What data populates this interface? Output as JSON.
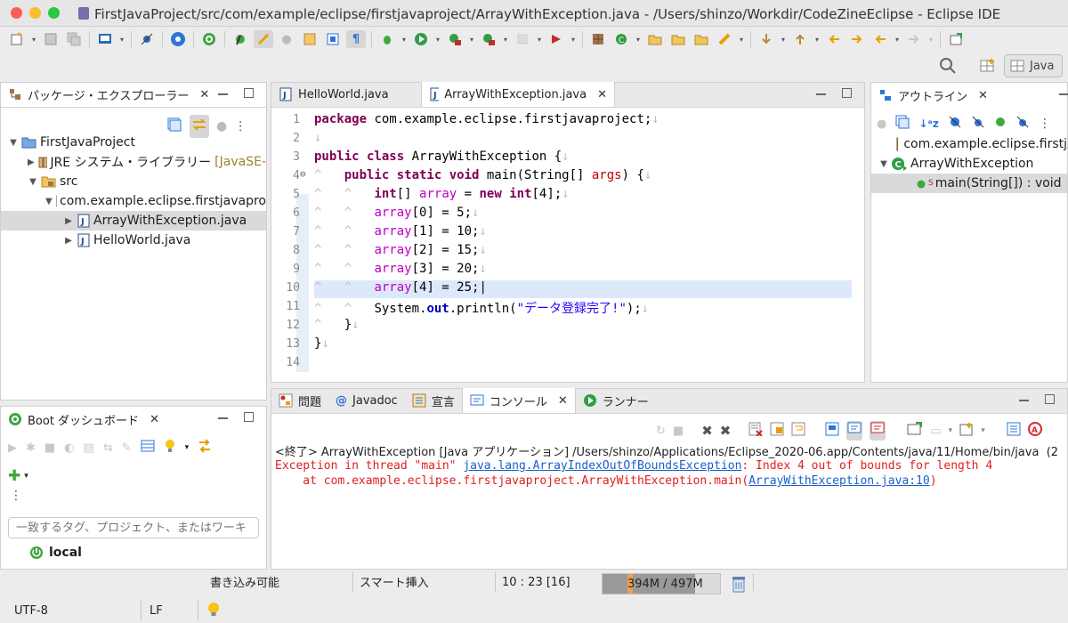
{
  "window": {
    "title": "FirstJavaProject/src/com/example/eclipse/firstjavaproject/ArrayWithException.java - /Users/shinzo/Workdir/CodeZineEclipse - Eclipse IDE",
    "perspective": "Java"
  },
  "colors": {
    "close": "#fc5f57",
    "minimize": "#fdbc2e",
    "zoom": "#28c840",
    "accent": "#2e74d8"
  },
  "explorer": {
    "tab_label": "パッケージ・エクスプローラー",
    "tree": [
      {
        "label": "FirstJavaProject",
        "icon": "project-folder-icon",
        "twisty": "▼"
      },
      {
        "label": "JRE システム・ライブラリー",
        "suffix": "[JavaSE-",
        "icon": "library-icon",
        "twisty": "▶"
      },
      {
        "label": "src",
        "icon": "source-folder-icon",
        "twisty": "▼"
      },
      {
        "label": "com.example.eclipse.firstjavapro",
        "icon": "package-icon",
        "twisty": "▼"
      },
      {
        "label": "ArrayWithException.java",
        "icon": "java-file-icon",
        "twisty": "▶"
      },
      {
        "label": "HelloWorld.java",
        "icon": "java-file-icon",
        "twisty": "▶"
      }
    ]
  },
  "boot": {
    "tab_label": "Boot ダッシュボード",
    "filter_placeholder": "一致するタグ、プロジェクト、またはワーキ",
    "local_label": "local"
  },
  "editor": {
    "tabs": [
      {
        "label": "HelloWorld.java"
      },
      {
        "label": "ArrayWithException.java",
        "active": true
      }
    ],
    "line_numbers": [
      "1",
      "2",
      "3",
      "4",
      "5",
      "6",
      "7",
      "8",
      "9",
      "10",
      "11",
      "12",
      "13",
      "14"
    ],
    "cursor_line": 10,
    "lines": [
      "<span class=\"kw\">package</span> com.example.eclipse.firstjavaproject;<span class=\"ws\">↓</span>",
      "<span class=\"ws\">↓</span>",
      "<span class=\"kw\">public class</span> ArrayWithException {<span class=\"ws\">↓</span>",
      "<span class=\"ws\">^   </span><span class=\"kw\">public static void</span> main(String[] <span style=\"color:#c00000\">args</span>) {<span class=\"ws\">↓</span>",
      "<span class=\"ws\">^   ^   </span><span class=\"kw\">int</span>[] <span class=\"fld\">array</span> = <span class=\"kw\">new int</span>[4];<span class=\"ws\">↓</span>",
      "<span class=\"ws\">^   ^   </span><span class=\"fld\">array</span>[0] = 5;<span class=\"ws\">↓</span>",
      "<span class=\"ws\">^   ^   </span><span class=\"fld\">array</span>[1] = 10;<span class=\"ws\">↓</span>",
      "<span class=\"ws\">^   ^   </span><span class=\"fld\">array</span>[2] = 15;<span class=\"ws\">↓</span>",
      "<span class=\"ws\">^   ^   </span><span class=\"fld\">array</span>[3] = 20;<span class=\"ws\">↓</span>",
      "<span class=\"ws\">^   ^   </span><span class=\"fld\">array</span>[4] = 25;|",
      "<span class=\"ws\">^   ^   </span>System.<span class=\"stat\">out</span>.println(<span class=\"str\">\"データ登録完了!\"</span>);<span class=\"ws\">↓</span>",
      "<span class=\"ws\">^   </span>}<span class=\"ws\">↓</span>",
      "}<span class=\"ws\">↓</span>",
      ""
    ]
  },
  "outline": {
    "tab_label": "アウトライン",
    "items": [
      {
        "label": "com.example.eclipse.firstj"
      },
      {
        "label": "ArrayWithException"
      },
      {
        "label": "main(String[]) : void",
        "marker": "S"
      }
    ]
  },
  "console": {
    "tabs": [
      {
        "label": "問題"
      },
      {
        "label": "Javadoc"
      },
      {
        "label": "宣言"
      },
      {
        "label": "コンソール",
        "active": true
      },
      {
        "label": "ランナー"
      }
    ],
    "header": "<終了> ArrayWithException [Java アプリケーション] /Users/shinzo/Applications/Eclipse_2020-06.app/Contents/java/11/Home/bin/java  (2",
    "err1_prefix": "Exception in thread \"main\" ",
    "err1_link": "java.lang.ArrayIndexOutOfBoundsException",
    "err1_suffix": ": Index 4 out of bounds for length 4",
    "err2_prefix": "    at com.example.eclipse.firstjavaproject.ArrayWithException.main(",
    "err2_link": "ArrayWithException.java:10",
    "err2_suffix": ")"
  },
  "status": {
    "writable": "書き込み可能",
    "insert_mode": "スマート挿入",
    "position": "10 : 23 [16]",
    "heap": "394M / 497M",
    "heap_fraction": 0.79,
    "encoding": "UTF-8",
    "line_ending": "LF"
  }
}
